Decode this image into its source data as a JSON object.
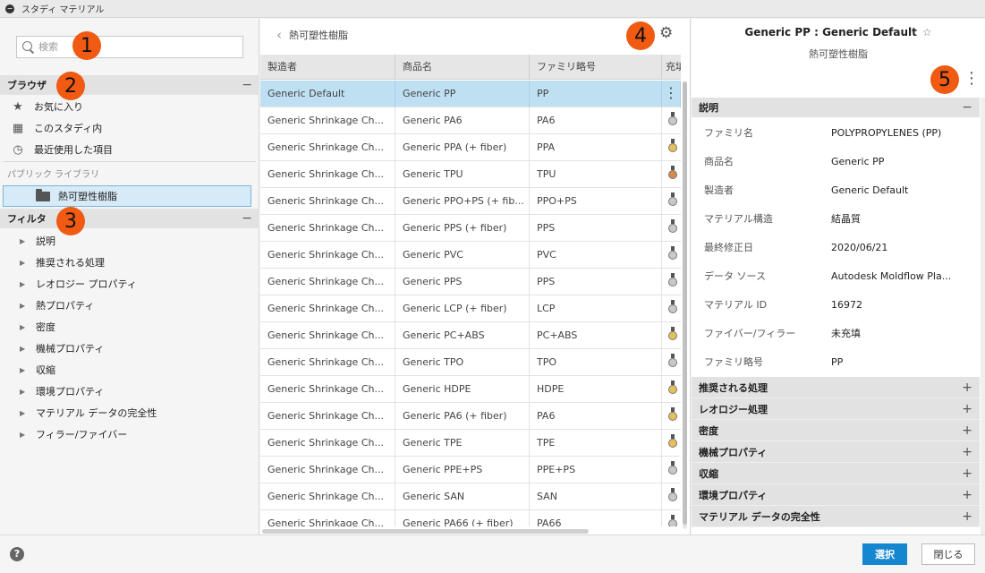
{
  "window": {
    "title": "スタディ マテリアル",
    "icon": "minus-circle-icon"
  },
  "callouts": [
    "1",
    "2",
    "3",
    "4",
    "5"
  ],
  "left": {
    "search_placeholder": "検索",
    "browse_header": "ブラウザ",
    "browse_items": [
      {
        "icon": "star-icon",
        "label": "お気に入り"
      },
      {
        "icon": "study-icon",
        "label": "このスタディ内"
      },
      {
        "icon": "clock-icon",
        "label": "最近使用した項目"
      }
    ],
    "public_library_label": "パブリック ライブラリ",
    "library_item": "熱可塑性樹脂",
    "filter_header": "フィルタ",
    "filters": [
      "説明",
      "推奨される処理",
      "レオロジー プロパティ",
      "熱プロパティ",
      "密度",
      "機械プロパティ",
      "収縮",
      "環境プロパティ",
      "マテリアル データの完全性",
      "フィラー/ファイバー"
    ]
  },
  "middle": {
    "breadcrumb": "熱可塑性樹脂",
    "columns": [
      "製造者",
      "商品名",
      "ファミリ略号",
      "充填"
    ],
    "rows": [
      {
        "maker": "Generic Default",
        "name": "Generic PP",
        "family": "PP",
        "medal": "kebab"
      },
      {
        "maker": "Generic Shrinkage Ch...",
        "name": "Generic PA6",
        "family": "PA6",
        "medal": "silver"
      },
      {
        "maker": "Generic Shrinkage Ch...",
        "name": "Generic PPA (+ fiber)",
        "family": "PPA",
        "medal": "gold"
      },
      {
        "maker": "Generic Shrinkage Ch...",
        "name": "Generic TPU",
        "family": "TPU",
        "medal": "bronze"
      },
      {
        "maker": "Generic Shrinkage Ch...",
        "name": "Generic PPO+PS (+ fib...",
        "family": "PPO+PS",
        "medal": "silver"
      },
      {
        "maker": "Generic Shrinkage Ch...",
        "name": "Generic PPS (+ fiber)",
        "family": "PPS",
        "medal": "silver"
      },
      {
        "maker": "Generic Shrinkage Ch...",
        "name": "Generic PVC",
        "family": "PVC",
        "medal": "silver"
      },
      {
        "maker": "Generic Shrinkage Ch...",
        "name": "Generic PPS",
        "family": "PPS",
        "medal": "silver"
      },
      {
        "maker": "Generic Shrinkage Ch...",
        "name": "Generic LCP (+ fiber)",
        "family": "LCP",
        "medal": "silver"
      },
      {
        "maker": "Generic Shrinkage Ch...",
        "name": "Generic PC+ABS",
        "family": "PC+ABS",
        "medal": "gold"
      },
      {
        "maker": "Generic Shrinkage Ch...",
        "name": "Generic TPO",
        "family": "TPO",
        "medal": "silver"
      },
      {
        "maker": "Generic Shrinkage Ch...",
        "name": "Generic HDPE",
        "family": "HDPE",
        "medal": "gold"
      },
      {
        "maker": "Generic Shrinkage Ch...",
        "name": "Generic PA6 (+ fiber)",
        "family": "PA6",
        "medal": "gold"
      },
      {
        "maker": "Generic Shrinkage Ch...",
        "name": "Generic TPE",
        "family": "TPE",
        "medal": "gold"
      },
      {
        "maker": "Generic Shrinkage Ch...",
        "name": "Generic PPE+PS",
        "family": "PPE+PS",
        "medal": "silver"
      },
      {
        "maker": "Generic Shrinkage Ch...",
        "name": "Generic SAN",
        "family": "SAN",
        "medal": "silver"
      },
      {
        "maker": "Generic Shrinkage Ch...",
        "name": "Generic PA66 (+ fiber)",
        "family": "PA66",
        "medal": "silver"
      }
    ]
  },
  "right": {
    "title": "Generic PP : Generic Default",
    "subtitle": "熱可塑性樹脂",
    "description_header": "説明",
    "properties": [
      {
        "key": "ファミリ名",
        "value": "POLYPROPYLENES (PP)"
      },
      {
        "key": "商品名",
        "value": "Generic PP"
      },
      {
        "key": "製造者",
        "value": "Generic Default"
      },
      {
        "key": "マテリアル構造",
        "value": "結晶質"
      },
      {
        "key": "最終修正日",
        "value": "2020/06/21"
      },
      {
        "key": "データ ソース",
        "value": "Autodesk Moldflow Pla..."
      },
      {
        "key": "マテリアル ID",
        "value": "16972"
      },
      {
        "key": "ファイバー/フィラー",
        "value": "未充填"
      },
      {
        "key": "ファミリ略号",
        "value": "PP"
      }
    ],
    "sections": [
      "推奨される処理",
      "レオロジー処理",
      "密度",
      "機械プロパティ",
      "収縮",
      "環境プロパティ",
      "マテリアル データの完全性"
    ]
  },
  "footer": {
    "help": "?",
    "select_label": "選択",
    "close_label": "閉じる"
  },
  "colors": {
    "accent": "#1487d0",
    "callout": "#f05a12",
    "selected_row": "#bfe0f2",
    "gold": "#e8c05a",
    "silver": "#c8c8c8",
    "bronze": "#d88a4a"
  }
}
